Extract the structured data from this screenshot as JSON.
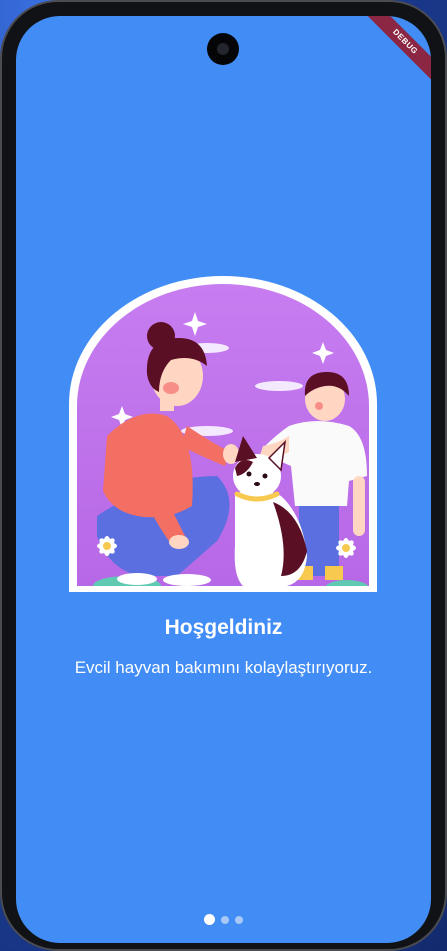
{
  "app": {
    "debug_banner": "DEBUG"
  },
  "onboarding": {
    "title": "Hoşgeldiniz",
    "subtitle": "Evcil hayvan bakımını kolaylaştırıyoruz.",
    "illustration_icon": "woman-child-dog-illustration",
    "page_index": 1,
    "page_count": 3
  },
  "colors": {
    "screen_background": "#428df5",
    "illustration_background": "#c77df0",
    "dot_active": "#ffffff",
    "dot_inactive": "#a9c8f6",
    "debug_ribbon": "#8b2742"
  }
}
